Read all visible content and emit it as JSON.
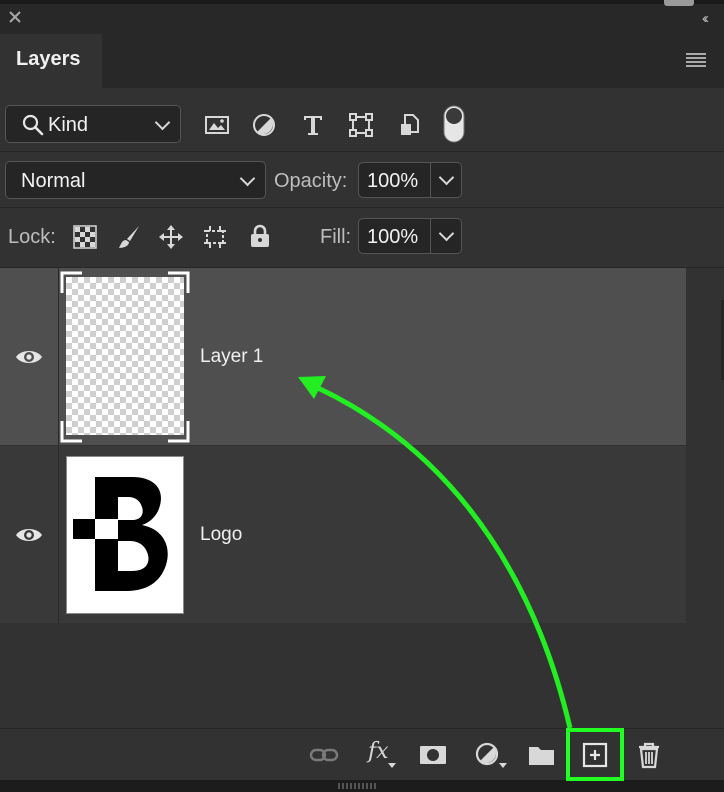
{
  "panel": {
    "title": "Layers"
  },
  "filter": {
    "kind_label": "Kind",
    "icons": [
      "image-filter-icon",
      "adjustment-filter-icon",
      "type-filter-icon",
      "shape-filter-icon",
      "smart-object-filter-icon",
      "filter-toggle-icon"
    ]
  },
  "blend": {
    "mode": "Normal",
    "opacity_label": "Opacity:",
    "opacity": "100%"
  },
  "lock": {
    "label": "Lock:",
    "fill_label": "Fill:",
    "fill": "100%"
  },
  "layers": [
    {
      "name": "Layer 1",
      "visible": true,
      "selected": true,
      "thumbnail": "transparent"
    },
    {
      "name": "Logo",
      "visible": true,
      "selected": false,
      "thumbnail": "logo-b"
    }
  ],
  "bottom_toolbar": {
    "fx_label": "fx",
    "icons": [
      "link-layers-icon",
      "layer-style-icon",
      "add-mask-icon",
      "adjustment-layer-icon",
      "new-group-icon",
      "new-layer-icon",
      "delete-layer-icon"
    ],
    "highlighted": "new-layer-icon"
  },
  "colors": {
    "highlight": "#22ff22",
    "annotation_arrow": "#22ee22",
    "panel_bg": "#323232",
    "selected_layer": "#4f4f4f"
  }
}
